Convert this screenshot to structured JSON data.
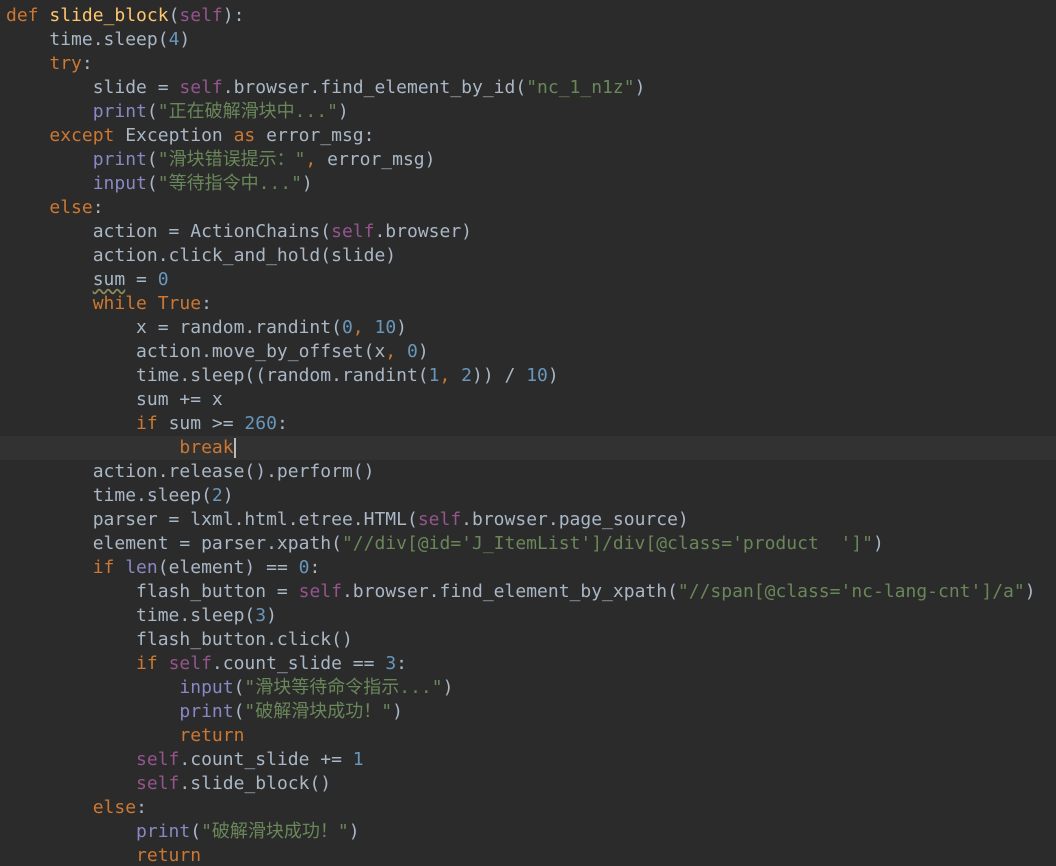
{
  "code": {
    "lines": [
      [
        {
          "t": "def ",
          "c": "kw"
        },
        {
          "t": "slide_block",
          "c": "fn"
        },
        {
          "t": "(",
          "c": ""
        },
        {
          "t": "self",
          "c": "self"
        },
        {
          "t": "):",
          "c": ""
        }
      ],
      [
        {
          "t": "    time.sleep(",
          "c": ""
        },
        {
          "t": "4",
          "c": "num"
        },
        {
          "t": ")",
          "c": ""
        }
      ],
      [
        {
          "t": "    ",
          "c": ""
        },
        {
          "t": "try",
          "c": "kw"
        },
        {
          "t": ":",
          "c": ""
        }
      ],
      [
        {
          "t": "        slide = ",
          "c": ""
        },
        {
          "t": "self",
          "c": "self"
        },
        {
          "t": ".browser.find_element_by_id(",
          "c": ""
        },
        {
          "t": "\"nc_1_n1z\"",
          "c": "str"
        },
        {
          "t": ")",
          "c": ""
        }
      ],
      [
        {
          "t": "        ",
          "c": ""
        },
        {
          "t": "print",
          "c": "bi"
        },
        {
          "t": "(",
          "c": ""
        },
        {
          "t": "\"正在破解滑块中...\"",
          "c": "str"
        },
        {
          "t": ")",
          "c": ""
        }
      ],
      [
        {
          "t": "    ",
          "c": ""
        },
        {
          "t": "except ",
          "c": "kw"
        },
        {
          "t": "Exception ",
          "c": "cls"
        },
        {
          "t": "as ",
          "c": "kw"
        },
        {
          "t": "error_msg:",
          "c": ""
        }
      ],
      [
        {
          "t": "        ",
          "c": ""
        },
        {
          "t": "print",
          "c": "bi"
        },
        {
          "t": "(",
          "c": ""
        },
        {
          "t": "\"滑块错误提示：\"",
          "c": "str"
        },
        {
          "t": ", ",
          "c": "kw"
        },
        {
          "t": "error_msg)",
          "c": ""
        }
      ],
      [
        {
          "t": "        ",
          "c": ""
        },
        {
          "t": "input",
          "c": "bi"
        },
        {
          "t": "(",
          "c": ""
        },
        {
          "t": "\"等待指令中...\"",
          "c": "str"
        },
        {
          "t": ")",
          "c": ""
        }
      ],
      [
        {
          "t": "    ",
          "c": ""
        },
        {
          "t": "else",
          "c": "kw"
        },
        {
          "t": ":",
          "c": ""
        }
      ],
      [
        {
          "t": "        action = ActionChains(",
          "c": ""
        },
        {
          "t": "self",
          "c": "self"
        },
        {
          "t": ".browser)",
          "c": ""
        }
      ],
      [
        {
          "t": "        action.click_and_hold(slide)",
          "c": ""
        }
      ],
      [
        {
          "t": "        ",
          "c": ""
        },
        {
          "t": "sum",
          "c": "warn"
        },
        {
          "t": " = ",
          "c": ""
        },
        {
          "t": "0",
          "c": "num"
        }
      ],
      [
        {
          "t": "        ",
          "c": ""
        },
        {
          "t": "while True",
          "c": "kw"
        },
        {
          "t": ":",
          "c": ""
        }
      ],
      [
        {
          "t": "            x = random.randint(",
          "c": ""
        },
        {
          "t": "0",
          "c": "num"
        },
        {
          "t": ", ",
          "c": "kw"
        },
        {
          "t": "10",
          "c": "num"
        },
        {
          "t": ")",
          "c": ""
        }
      ],
      [
        {
          "t": "            action.move_by_offset(x",
          "c": ""
        },
        {
          "t": ", ",
          "c": "kw"
        },
        {
          "t": "0",
          "c": "num"
        },
        {
          "t": ")",
          "c": ""
        }
      ],
      [
        {
          "t": "            time.sleep((random.randint(",
          "c": ""
        },
        {
          "t": "1",
          "c": "num"
        },
        {
          "t": ", ",
          "c": "kw"
        },
        {
          "t": "2",
          "c": "num"
        },
        {
          "t": ")) / ",
          "c": ""
        },
        {
          "t": "10",
          "c": "num"
        },
        {
          "t": ")",
          "c": ""
        }
      ],
      [
        {
          "t": "            sum += x",
          "c": ""
        }
      ],
      [
        {
          "t": "            ",
          "c": ""
        },
        {
          "t": "if ",
          "c": "kw"
        },
        {
          "t": "sum >= ",
          "c": ""
        },
        {
          "t": "260",
          "c": "num"
        },
        {
          "t": ":",
          "c": ""
        }
      ],
      [
        {
          "t": "                ",
          "c": ""
        },
        {
          "t": "break",
          "c": "kw"
        }
      ],
      [
        {
          "t": "        action.release().perform()",
          "c": ""
        }
      ],
      [
        {
          "t": "        time.sleep(",
          "c": ""
        },
        {
          "t": "2",
          "c": "num"
        },
        {
          "t": ")",
          "c": ""
        }
      ],
      [
        {
          "t": "        parser = lxml.html.etree.HTML(",
          "c": ""
        },
        {
          "t": "self",
          "c": "self"
        },
        {
          "t": ".browser.page_source)",
          "c": ""
        }
      ],
      [
        {
          "t": "        element = parser.xpath(",
          "c": ""
        },
        {
          "t": "\"//div[@id='J_ItemList']/div[@class='product  ']\"",
          "c": "str"
        },
        {
          "t": ")",
          "c": ""
        }
      ],
      [
        {
          "t": "        ",
          "c": ""
        },
        {
          "t": "if ",
          "c": "kw"
        },
        {
          "t": "len",
          "c": "bi"
        },
        {
          "t": "(element) == ",
          "c": ""
        },
        {
          "t": "0",
          "c": "num"
        },
        {
          "t": ":",
          "c": ""
        }
      ],
      [
        {
          "t": "            flash_button = ",
          "c": ""
        },
        {
          "t": "self",
          "c": "self"
        },
        {
          "t": ".browser.find_element_by_xpath(",
          "c": ""
        },
        {
          "t": "\"//span[@class='nc-lang-cnt']/a\"",
          "c": "str"
        },
        {
          "t": ")",
          "c": ""
        }
      ],
      [
        {
          "t": "            time.sleep(",
          "c": ""
        },
        {
          "t": "3",
          "c": "num"
        },
        {
          "t": ")",
          "c": ""
        }
      ],
      [
        {
          "t": "            flash_button.click()",
          "c": ""
        }
      ],
      [
        {
          "t": "            ",
          "c": ""
        },
        {
          "t": "if ",
          "c": "kw"
        },
        {
          "t": "self",
          "c": "self"
        },
        {
          "t": ".count_slide == ",
          "c": ""
        },
        {
          "t": "3",
          "c": "num"
        },
        {
          "t": ":",
          "c": ""
        }
      ],
      [
        {
          "t": "                ",
          "c": ""
        },
        {
          "t": "input",
          "c": "bi"
        },
        {
          "t": "(",
          "c": ""
        },
        {
          "t": "\"滑块等待命令指示...\"",
          "c": "str"
        },
        {
          "t": ")",
          "c": ""
        }
      ],
      [
        {
          "t": "                ",
          "c": ""
        },
        {
          "t": "print",
          "c": "bi"
        },
        {
          "t": "(",
          "c": ""
        },
        {
          "t": "\"破解滑块成功！\"",
          "c": "str"
        },
        {
          "t": ")",
          "c": ""
        }
      ],
      [
        {
          "t": "                ",
          "c": ""
        },
        {
          "t": "return",
          "c": "kw"
        }
      ],
      [
        {
          "t": "            ",
          "c": ""
        },
        {
          "t": "self",
          "c": "self"
        },
        {
          "t": ".count_slide += ",
          "c": ""
        },
        {
          "t": "1",
          "c": "num"
        }
      ],
      [
        {
          "t": "            ",
          "c": ""
        },
        {
          "t": "self",
          "c": "self"
        },
        {
          "t": ".slide_block()",
          "c": ""
        }
      ],
      [
        {
          "t": "        ",
          "c": ""
        },
        {
          "t": "else",
          "c": "kw"
        },
        {
          "t": ":",
          "c": ""
        }
      ],
      [
        {
          "t": "            ",
          "c": ""
        },
        {
          "t": "print",
          "c": "bi"
        },
        {
          "t": "(",
          "c": ""
        },
        {
          "t": "\"破解滑块成功！\"",
          "c": "str"
        },
        {
          "t": ")",
          "c": ""
        }
      ],
      [
        {
          "t": "            ",
          "c": ""
        },
        {
          "t": "return",
          "c": "kw"
        }
      ]
    ],
    "current_line": 18
  },
  "colors": {
    "background": "#2b2b2b",
    "default_text": "#a9b7c6",
    "keyword": "#cc7832",
    "function_name": "#ffc66d",
    "self": "#94558d",
    "string": "#6a8759",
    "number": "#6897bb",
    "builtin": "#8888c6",
    "current_line_bg": "#323232"
  }
}
